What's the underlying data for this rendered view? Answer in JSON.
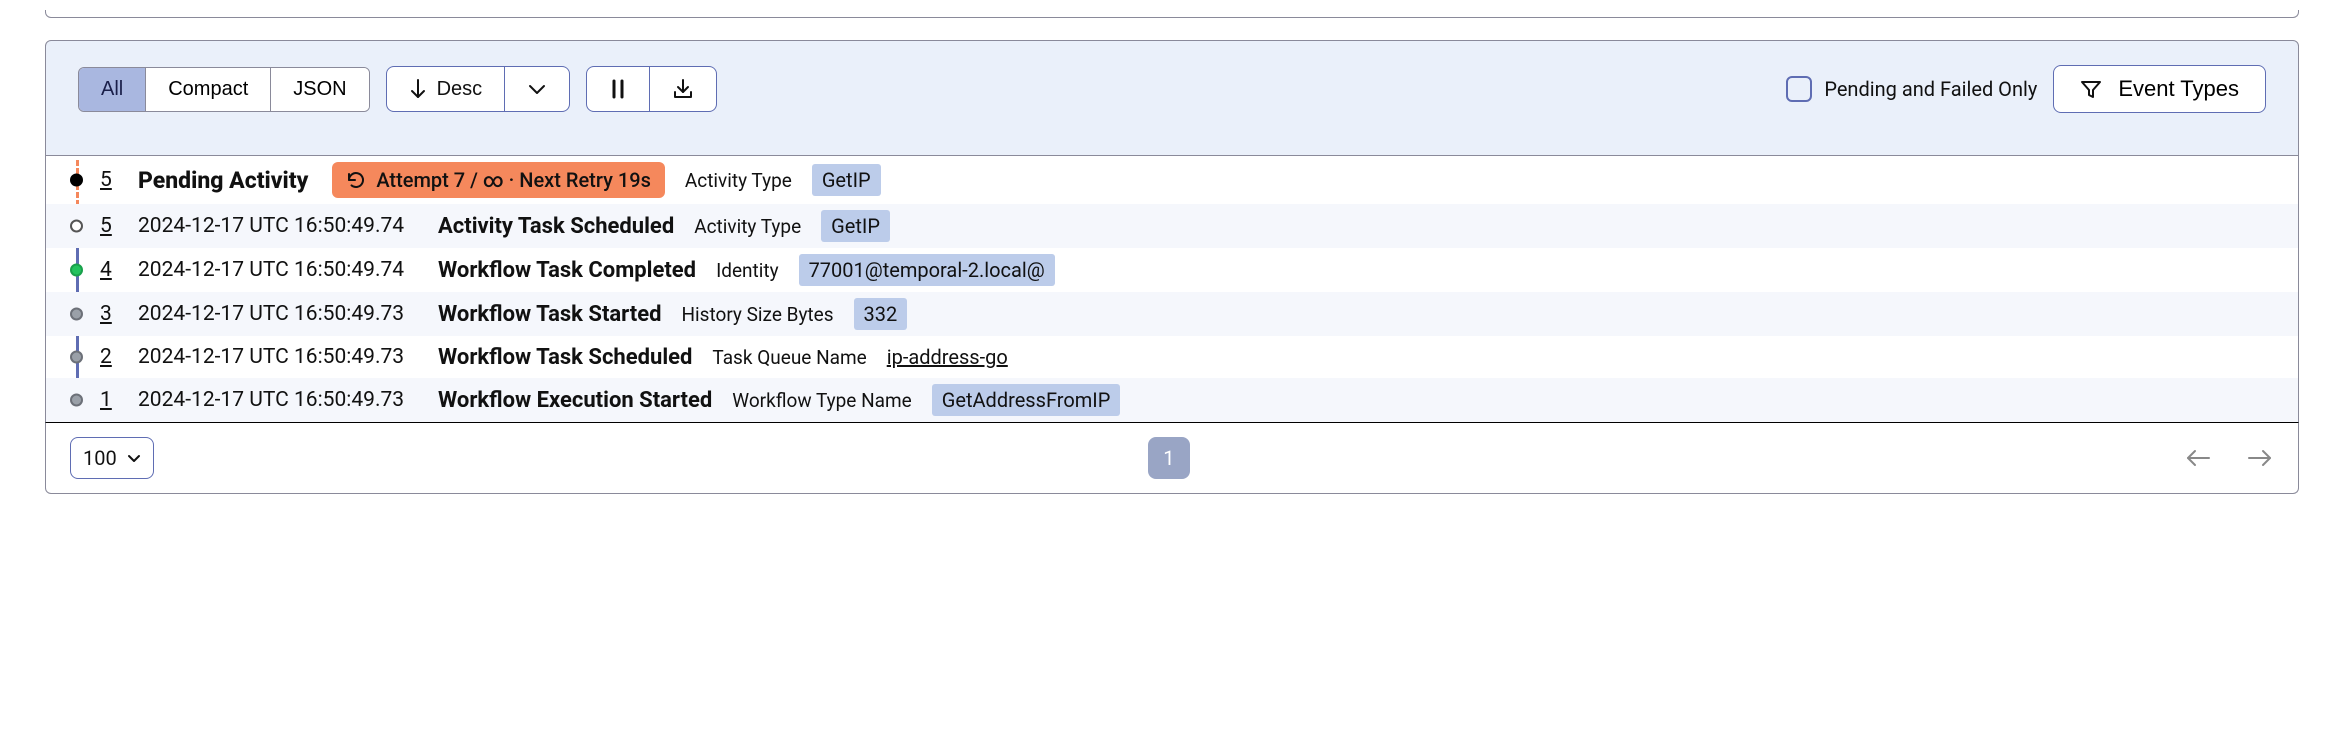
{
  "toolbar": {
    "views": {
      "all": "All",
      "compact": "Compact",
      "json": "JSON",
      "active": "all"
    },
    "sort_label": "Desc",
    "pending_failed_label": "Pending and Failed Only",
    "event_types_label": "Event Types"
  },
  "pending": {
    "id": "5",
    "title": "Pending Activity",
    "pill_text": "Attempt 7 / ∞ · Next Retry 19s",
    "attr_label": "Activity Type",
    "attr_value": "GetIP"
  },
  "events": [
    {
      "id": "5",
      "ts": "2024-12-17 UTC 16:50:49.74",
      "name": "Activity Task Scheduled",
      "attr_label": "Activity Type",
      "attr_value": "GetIP",
      "attr_style": "chip",
      "dot": "hollow"
    },
    {
      "id": "4",
      "ts": "2024-12-17 UTC 16:50:49.74",
      "name": "Workflow Task Completed",
      "attr_label": "Identity",
      "attr_value": "77001@temporal-2.local@",
      "attr_style": "chip",
      "dot": "green"
    },
    {
      "id": "3",
      "ts": "2024-12-17 UTC 16:50:49.73",
      "name": "Workflow Task Started",
      "attr_label": "History Size Bytes",
      "attr_value": "332",
      "attr_style": "chip",
      "dot": "gray"
    },
    {
      "id": "2",
      "ts": "2024-12-17 UTC 16:50:49.73",
      "name": "Workflow Task Scheduled",
      "attr_label": "Task Queue Name",
      "attr_value": "ip-address-go",
      "attr_style": "link",
      "dot": "gray"
    },
    {
      "id": "1",
      "ts": "2024-12-17 UTC 16:50:49.73",
      "name": "Workflow Execution Started",
      "attr_label": "Workflow Type Name",
      "attr_value": "GetAddressFromIP",
      "attr_style": "chip",
      "dot": "gray"
    }
  ],
  "footer": {
    "page_size": "100",
    "current_page": "1"
  }
}
